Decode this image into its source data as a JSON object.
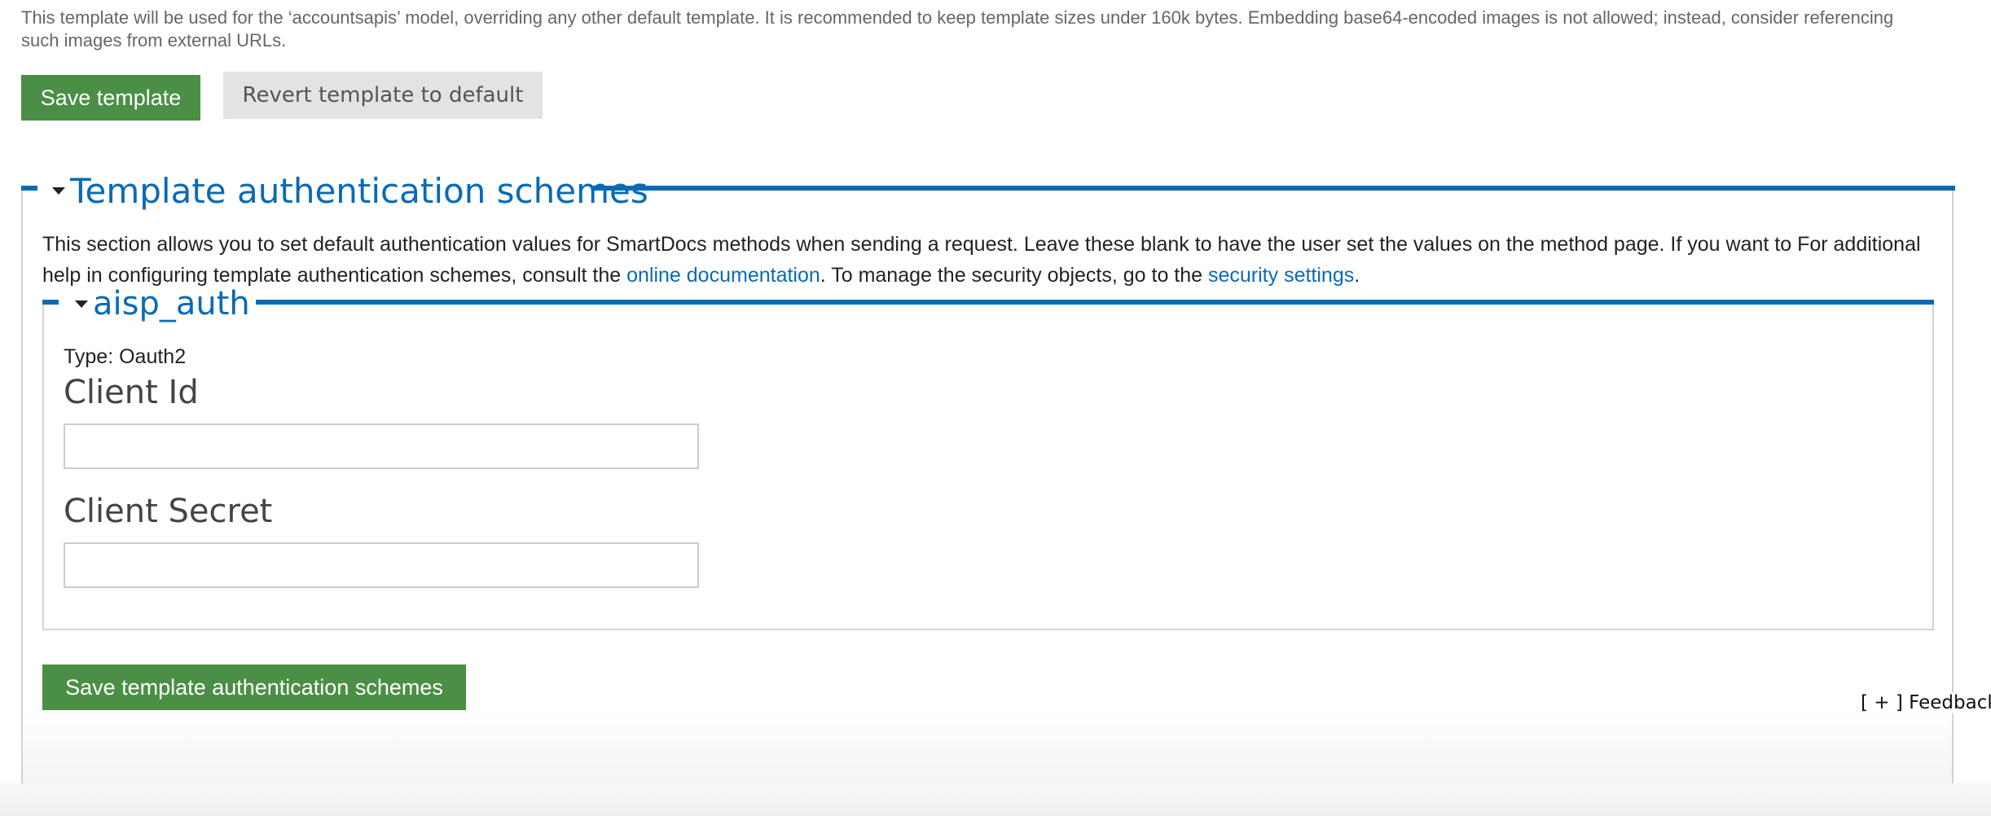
{
  "help_text": "This template will be used for the ‘accountsapis’ model, overriding any other default template. It is recommended to keep template sizes under 160k bytes. Embedding base64-encoded images is not allowed; instead, consider referencing such images from external URLs.",
  "buttons": {
    "save_template": "Save template",
    "revert_template": "Revert template to default",
    "save_auth_schemes": "Save template authentication schemes"
  },
  "auth_section": {
    "legend": "Template authentication schemes",
    "description_part1": "This section allows you to set default authentication values for SmartDocs methods when sending a request. Leave these blank to have the user set the values on the method page. If you want to For additional help in configuring template authentication schemes, consult the ",
    "link_docs": "online documentation",
    "description_part2": ". To manage the security objects, go to the ",
    "link_security": "security settings",
    "description_part3": "."
  },
  "scheme": {
    "legend": "aisp_auth",
    "type_text": "Type: Oauth2",
    "fields": [
      {
        "label": "Client Id",
        "value": ""
      },
      {
        "label": "Client Secret",
        "value": ""
      }
    ]
  },
  "feedback_label": "[ + ] Feedback"
}
